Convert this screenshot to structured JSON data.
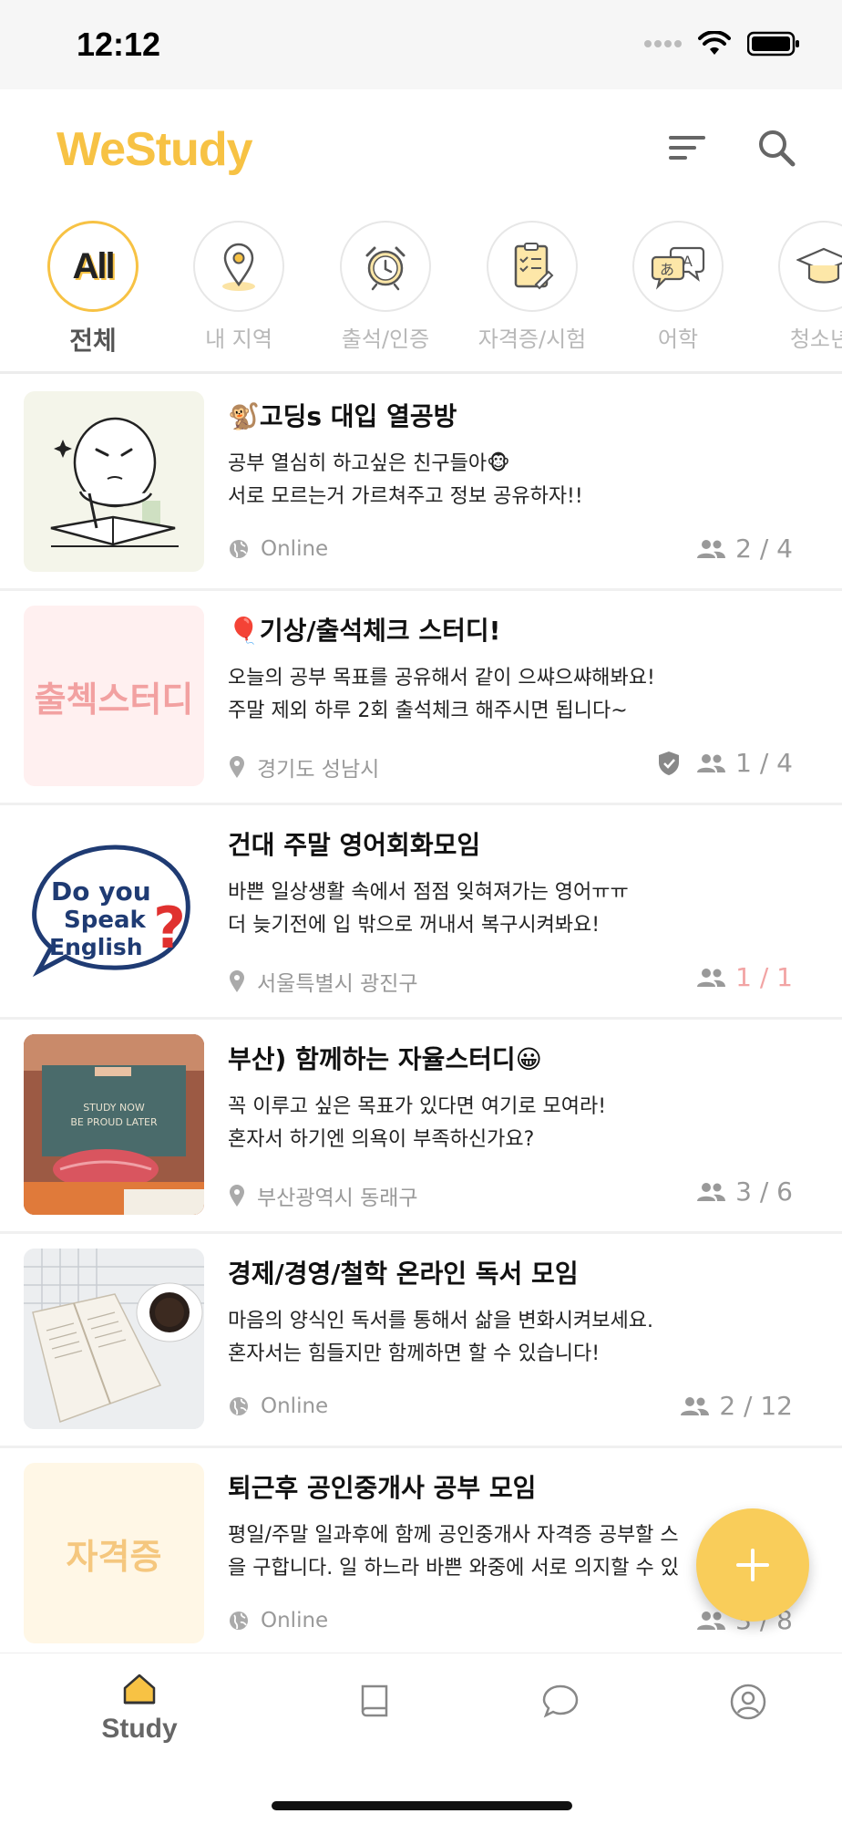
{
  "status_bar": {
    "time": "12:12"
  },
  "header": {
    "logo": "WeStudy",
    "filter_icon": "filter-icon",
    "search_icon": "search-icon"
  },
  "colors": {
    "accent": "#f7c244",
    "fab": "#f9cd5a",
    "muted": "#999999",
    "full_count": "#f2a4a4"
  },
  "categories": [
    {
      "label": "전체",
      "icon": "all-icon",
      "icon_text": "All",
      "active": true
    },
    {
      "label": "내 지역",
      "icon": "location-pin-icon"
    },
    {
      "label": "출석/인증",
      "icon": "alarm-clock-icon"
    },
    {
      "label": "자격증/시험",
      "icon": "document-checklist-icon"
    },
    {
      "label": "어학",
      "icon": "speech-bubbles-language-icon"
    },
    {
      "label": "청소년/",
      "icon": "graduation-cap-icon"
    }
  ],
  "studies": [
    {
      "title": "🐒고딩s 대입 열공방",
      "desc_line1": "공부 열심히 하고싶은 친구들아🐵",
      "desc_line2": "서로 모르는거 가르쳐주고 정보 공유하자!!",
      "location": "Online",
      "location_icon": "globe-icon",
      "members": "2 / 4",
      "full": false,
      "thumb": "studying-character-illustration"
    },
    {
      "title": "🎈기상/출석체크 스터디!",
      "desc_line1": "오늘의 공부 목표를 공유해서 같이 으쌰으쌰해봐요!",
      "desc_line2": "주말 제외 하루 2회 출석체크 해주시면 됩니다~",
      "location": "경기도 성남시",
      "location_icon": "map-pin-icon",
      "members": "1 / 4",
      "full": false,
      "verified": true,
      "thumb_text": "출첵스터디"
    },
    {
      "title": "건대 주말 영어회화모임",
      "desc_line1": "바쁜 일상생활 속에서 점점 잊혀져가는 영어ㅠㅠ",
      "desc_line2": "더 늦기전에 입 밖으로 꺼내서 복구시켜봐요!",
      "location": "서울특별시 광진구",
      "location_icon": "map-pin-icon",
      "members": "1 / 1",
      "full": true,
      "thumb_text_1": "Do you",
      "thumb_text_2": "Speak",
      "thumb_text_3": "English",
      "thumb_text_4": "?"
    },
    {
      "title": "부산) 함께하는 자율스터디😀",
      "desc_line1": "꼭 이루고 싶은 목표가 있다면 여기로 모여라!",
      "desc_line2": "혼자서 하기엔 의욕이 부족하신가요?",
      "location": "부산광역시 동래구",
      "location_icon": "map-pin-icon",
      "members": "3 / 6",
      "full": false,
      "thumb_text_1": "STUDY NOW",
      "thumb_text_2": "BE PROUD LATER"
    },
    {
      "title": "경제/경영/철학 온라인 독서 모임",
      "desc_line1": "마음의 양식인 독서를 통해서 삶을 변화시켜보세요.",
      "desc_line2": "혼자서는 힘들지만 함께하면 할 수 있습니다!",
      "location": "Online",
      "location_icon": "globe-icon",
      "members": "2 / 12",
      "full": false,
      "thumb": "open-book-coffee-photo"
    },
    {
      "title": "퇴근후 공인중개사 공부 모임",
      "desc_line1": "평일/주말 일과후에 함께 공인중개사 자격증 공부할 스",
      "desc_line2": "을 구합니다. 일 하느라 바쁜 와중에 서로 의지할 수 있",
      "location": "Online",
      "location_icon": "globe-icon",
      "members": "3 / 8",
      "full": false,
      "thumb_text": "자격증"
    }
  ],
  "fab": {
    "icon": "plus-icon"
  },
  "tabs": [
    {
      "label": "Study",
      "icon": "home-icon",
      "active": true
    },
    {
      "label": "",
      "icon": "book-icon"
    },
    {
      "label": "",
      "icon": "chat-bubble-icon"
    },
    {
      "label": "",
      "icon": "profile-icon"
    }
  ]
}
